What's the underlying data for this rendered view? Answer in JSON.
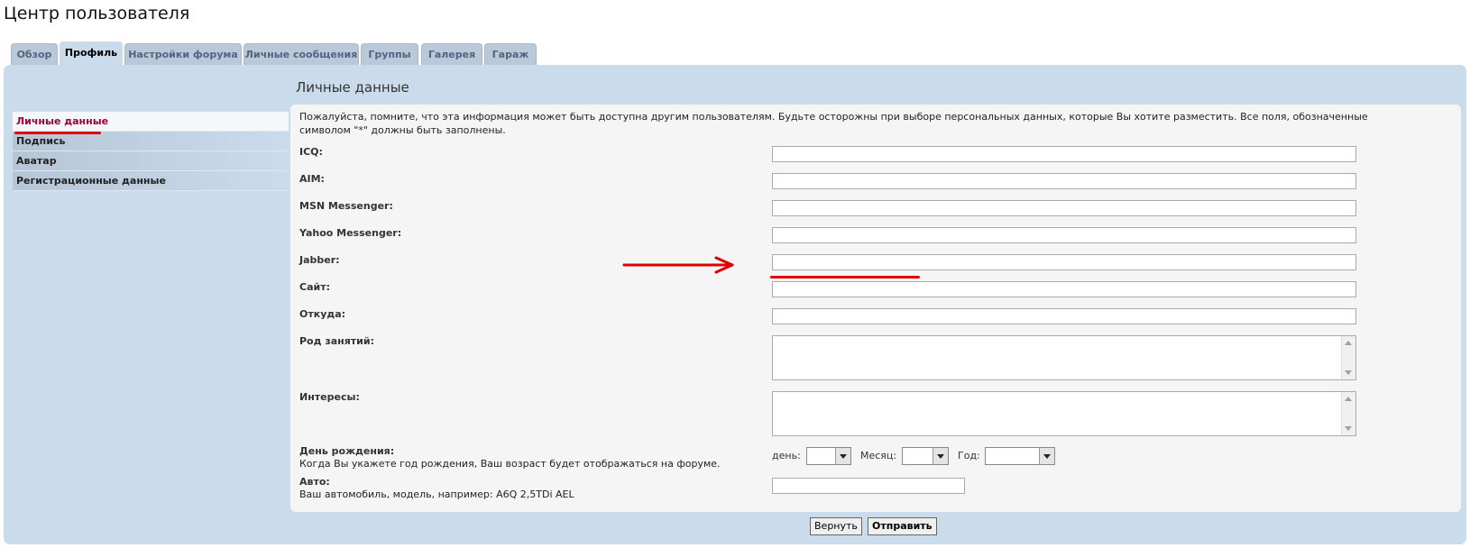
{
  "page_title": "Центр пользователя",
  "tabs": [
    {
      "label": "Обзор"
    },
    {
      "label": "Профиль"
    },
    {
      "label": "Настройки форума"
    },
    {
      "label": "Личные сообщения"
    },
    {
      "label": "Группы"
    },
    {
      "label": "Галерея"
    },
    {
      "label": "Гараж"
    }
  ],
  "active_tab": "Профиль",
  "sidebar": {
    "items": [
      {
        "label": "Личные данные"
      },
      {
        "label": "Подпись"
      },
      {
        "label": "Аватар"
      },
      {
        "label": "Регистрационные данные"
      }
    ]
  },
  "section_title": "Личные данные",
  "notice": "Пожалуйста, помните, что эта информация может быть доступна другим пользователям. Будьте осторожны при выборе персональных данных, которые Вы хотите разместить. Все поля, обозначенные символом \"*\" должны быть заполнены.",
  "fields": {
    "icq": {
      "label": "ICQ:",
      "value": ""
    },
    "aim": {
      "label": "AIM:",
      "value": ""
    },
    "msn": {
      "label": "MSN Messenger:",
      "value": ""
    },
    "yahoo": {
      "label": "Yahoo Messenger:",
      "value": ""
    },
    "jabber": {
      "label": "Jabber:",
      "value": ""
    },
    "site": {
      "label": "Сайт:",
      "value": ""
    },
    "location": {
      "label": "Откуда:",
      "value": ""
    },
    "occupation": {
      "label": "Род занятий:",
      "value": ""
    },
    "interests": {
      "label": "Интересы:",
      "value": ""
    },
    "birthday": {
      "label": "День рождения:",
      "hint": "Когда Вы укажете год рождения, Ваш возраст будет отображаться на форуме.",
      "day_label": "день:",
      "month_label": "Месяц:",
      "year_label": "Год:",
      "day_value": "",
      "month_value": "",
      "year_value": ""
    },
    "auto": {
      "label": "Авто:",
      "hint": "Ваш автомобиль, модель, например: A6Q 2,5TDi AEL",
      "value": ""
    }
  },
  "buttons": {
    "reset": "Вернуть",
    "submit": "Отправить"
  },
  "colors": {
    "panel_bg": "#cadceb",
    "content_bg": "#f5f5f5",
    "tab_text": "#536482",
    "active_side_text": "#a0003a",
    "annotation_red": "#e00000"
  }
}
